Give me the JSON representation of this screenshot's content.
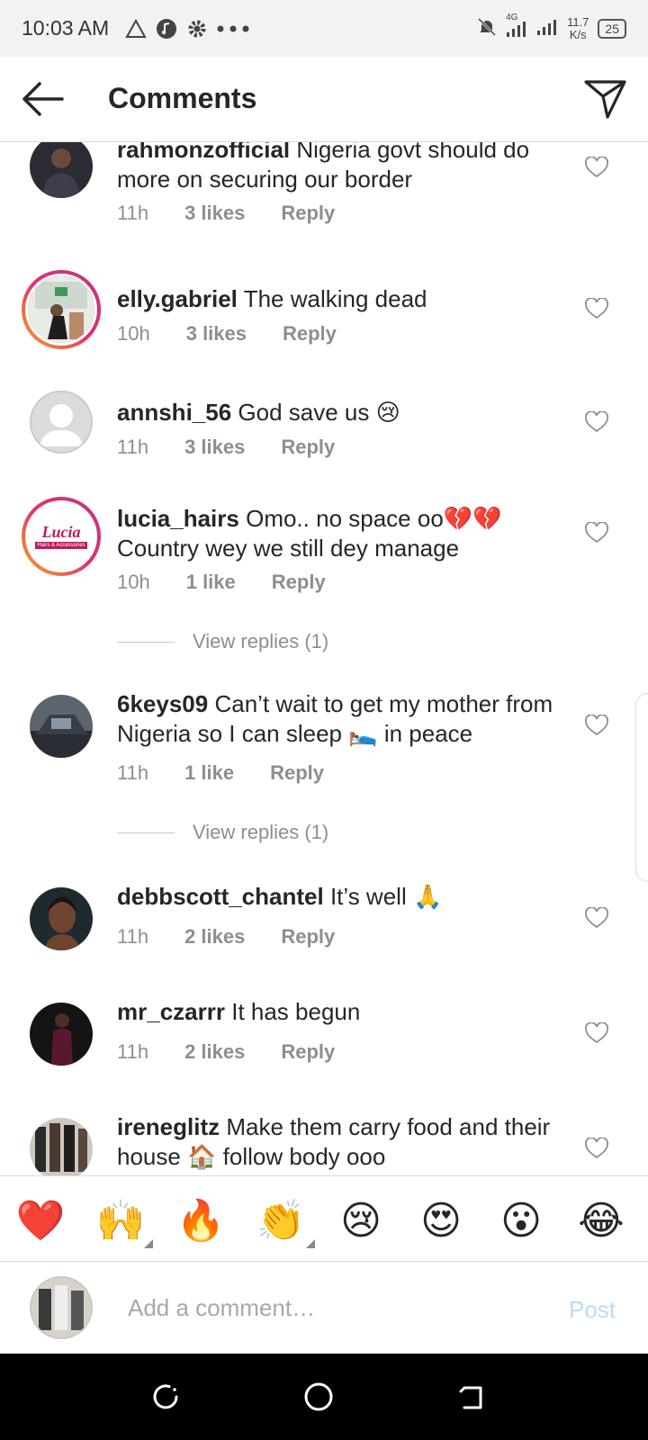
{
  "status_bar": {
    "time": "10:03 AM",
    "network": "4G",
    "speed_value": "11.7",
    "speed_unit": "K/s",
    "battery": "25"
  },
  "header": {
    "title": "Comments"
  },
  "comments": [
    {
      "username": "rahmonzofficial",
      "text": "Nigeria govt should do more on securing our border",
      "time": "11h",
      "likes": "3 likes",
      "reply": "Reply"
    },
    {
      "username": "elly.gabriel",
      "text": "The walking dead",
      "time": "10h",
      "likes": "3 likes",
      "reply": "Reply"
    },
    {
      "username": "annshi_56",
      "text": "God save us 😢",
      "time": "11h",
      "likes": "3 likes",
      "reply": "Reply"
    },
    {
      "username": "lucia_hairs",
      "text": "Omo.. no space oo💔💔 Country wey we still dey manage",
      "time": "10h",
      "likes": "1 like",
      "reply": "Reply",
      "view_replies": "View replies (1)",
      "avatar_text": "Lucia",
      "avatar_subtext": "Hairs & Accessories"
    },
    {
      "username": "6keys09",
      "text": "Can’t wait to get my mother from Nigeria so I can sleep 🛌 in peace",
      "time": "11h",
      "likes": "1 like",
      "reply": "Reply",
      "view_replies": "View replies (1)"
    },
    {
      "username": "debbscott_chantel",
      "text": "It’s well 🙏",
      "time": "11h",
      "likes": "2 likes",
      "reply": "Reply"
    },
    {
      "username": "mr_czarrr",
      "text": "It has begun",
      "time": "11h",
      "likes": "2 likes",
      "reply": "Reply"
    },
    {
      "username": "ireneglitz",
      "text": "Make them carry food and their house 🏠 follow body ooo",
      "time": "",
      "likes": "",
      "reply": ""
    }
  ],
  "emoji_bar": [
    "❤️",
    "🙌",
    "🔥",
    "👏",
    "😢",
    "😍",
    "😮",
    "😂"
  ],
  "input": {
    "placeholder": "Add a comment…",
    "post_label": "Post"
  },
  "colors": {
    "post_disabled": "#b9dcf8",
    "meta_gray": "#8e8e8e",
    "heart_red": "#ed4956"
  }
}
